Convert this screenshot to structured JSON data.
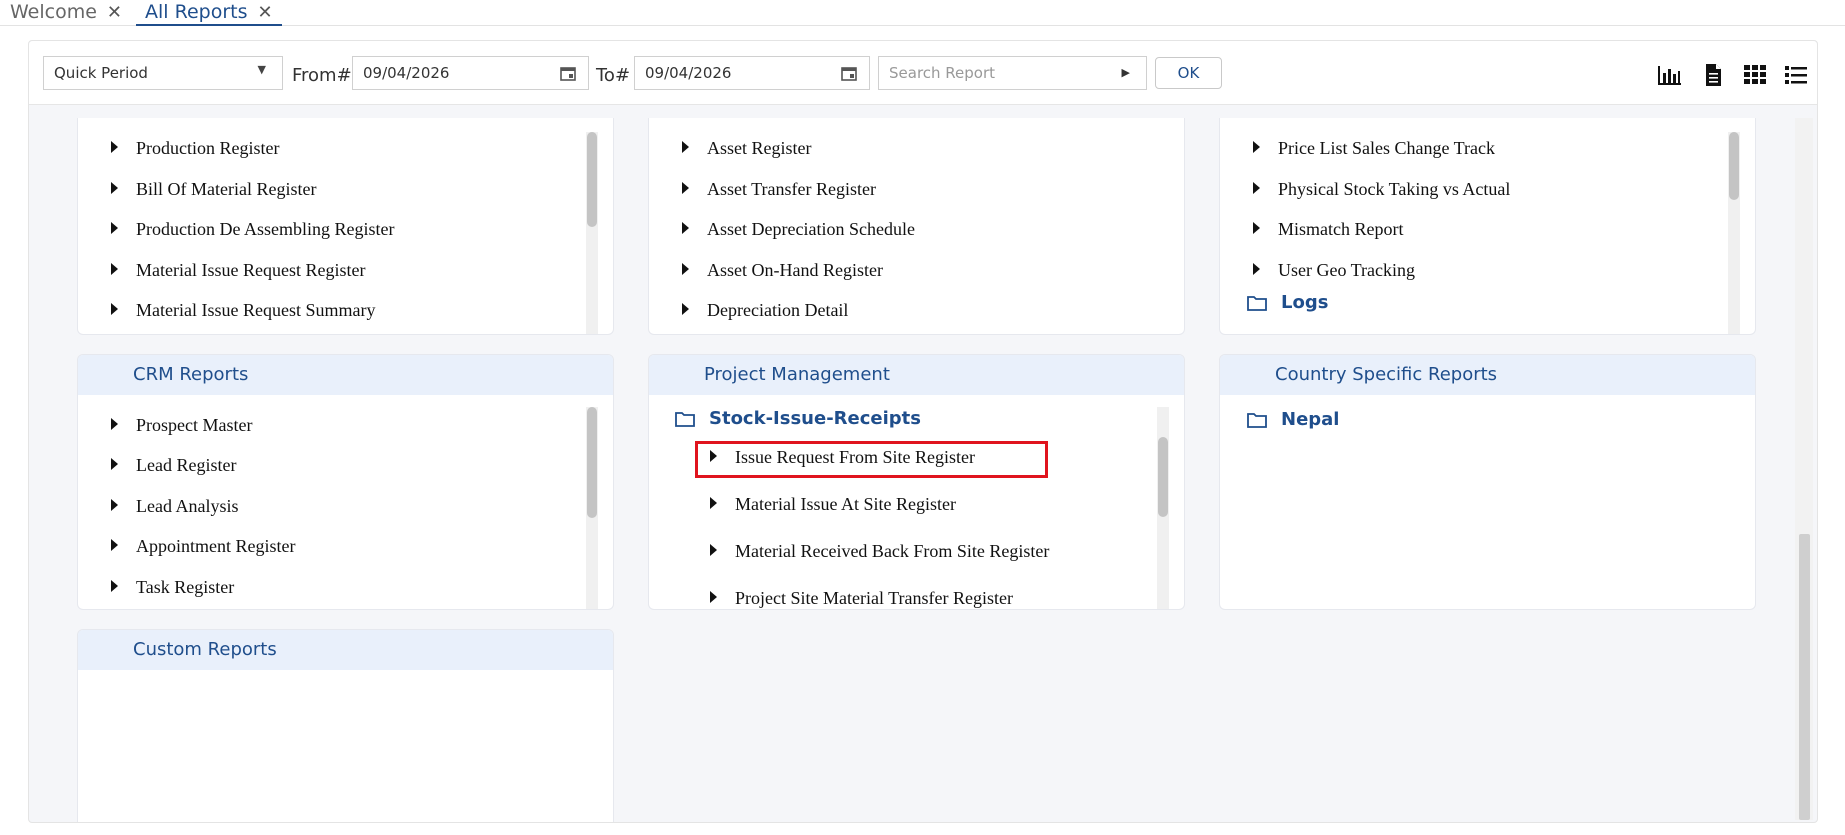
{
  "tabs": [
    {
      "label": "Welcome",
      "close": "✕"
    },
    {
      "label": "All Reports",
      "close": "✕"
    }
  ],
  "toolbar": {
    "period": "Quick Period",
    "from_label": "From#",
    "from_value": "09/04/2026",
    "to_label": "To#",
    "to_value": "09/04/2026",
    "search_placeholder": "Search Report",
    "ok_label": "OK",
    "view_icons": [
      "bar-chart-icon",
      "document-icon",
      "grid-icon",
      "list-icon"
    ]
  },
  "cards": {
    "production": {
      "items": [
        "Production Register",
        "Bill Of Material Register",
        "Production De Assembling Register",
        "Material Issue Request Register",
        "Material Issue Request Summary"
      ]
    },
    "asset": {
      "items": [
        "Asset Register",
        "Asset Transfer Register",
        "Asset Depreciation Schedule",
        "Asset On-Hand Register",
        "Depreciation Detail"
      ]
    },
    "misc": {
      "items": [
        "Price List Sales Change Track",
        "Physical Stock Taking vs Actual",
        "Mismatch Report",
        "User Geo Tracking"
      ],
      "folder": "Logs"
    },
    "crm": {
      "title": "CRM Reports",
      "items": [
        "Prospect Master",
        "Lead Register",
        "Lead Analysis",
        "Appointment Register",
        "Task Register"
      ]
    },
    "project": {
      "title": "Project Management",
      "folder": "Stock-Issue-Receipts",
      "items": [
        "Issue Request From Site Register",
        "Material Issue At Site Register",
        "Material Received Back From Site Register",
        "Project Site Material Transfer Register"
      ]
    },
    "country": {
      "title": "Country Specific Reports",
      "folder": "Nepal"
    },
    "custom": {
      "title": "Custom Reports"
    }
  },
  "colors": {
    "accent": "#1f4e8c",
    "header_bg": "#e9f0fb",
    "highlight": "#e0141e"
  }
}
